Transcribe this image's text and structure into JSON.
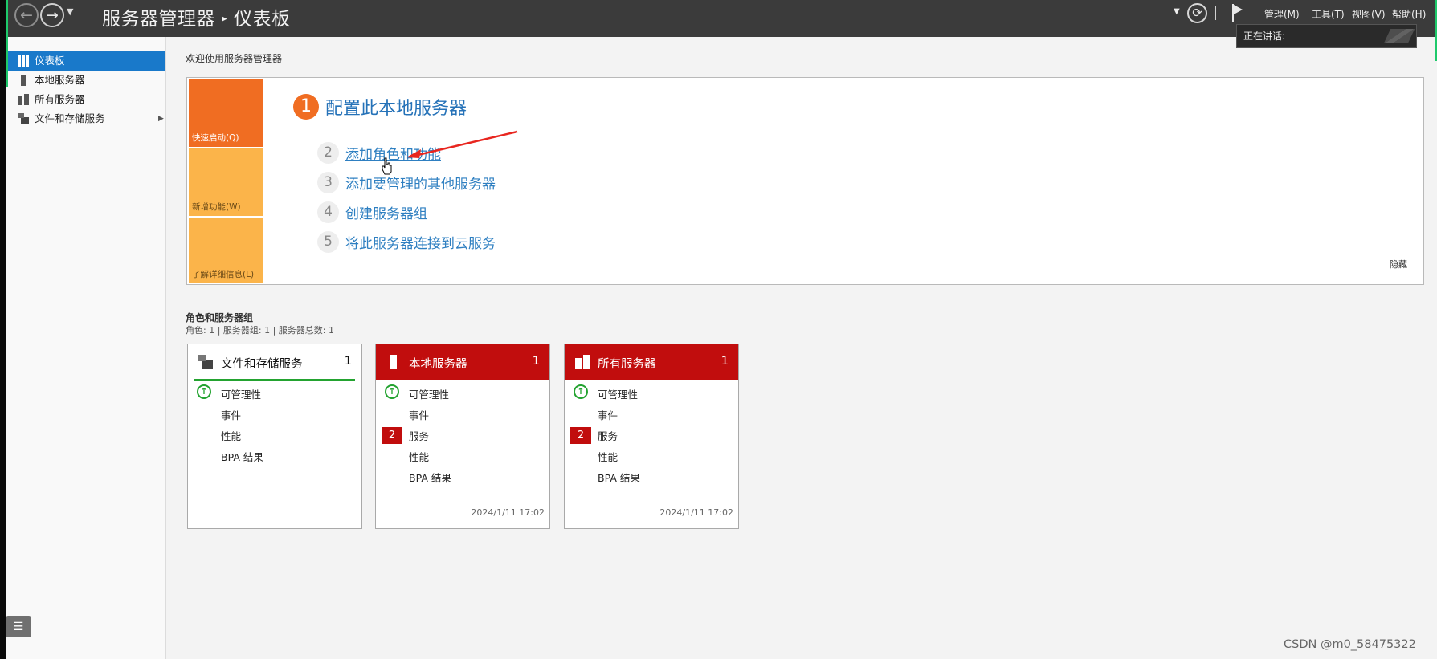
{
  "titlebar": {
    "app_title": "服务器管理器",
    "separator": "▸",
    "page_title": "仪表板",
    "menus": [
      "管理(M)",
      "工具(T)",
      "视图(V)",
      "帮助(H)"
    ],
    "tooltip": "正在讲话:"
  },
  "sidebar": {
    "items": [
      {
        "label": "仪表板",
        "icon": "dashboard-grid-icon",
        "active": true
      },
      {
        "label": "本地服务器",
        "icon": "server-icon",
        "active": false
      },
      {
        "label": "所有服务器",
        "icon": "servers-icon",
        "active": false
      },
      {
        "label": "文件和存储服务",
        "icon": "storage-icon",
        "active": false,
        "has_arrow": true
      }
    ]
  },
  "welcome": "欢迎使用服务器管理器",
  "quick_start": {
    "tiles": [
      "快速启动(Q)",
      "新增功能(W)",
      "了解详细信息(L)"
    ],
    "main_step": {
      "number": "1",
      "label": "配置此本地服务器"
    },
    "steps": [
      {
        "number": "2",
        "label": "添加角色和功能"
      },
      {
        "number": "3",
        "label": "添加要管理的其他服务器"
      },
      {
        "number": "4",
        "label": "创建服务器组"
      },
      {
        "number": "5",
        "label": "将此服务器连接到云服务"
      }
    ],
    "hide": "隐藏"
  },
  "roles": {
    "title": "角色和服务器组",
    "subtitle": "角色: 1 | 服务器组: 1 | 服务器总数: 1"
  },
  "tiles": [
    {
      "title": "文件和存储服务",
      "count": "1",
      "style": "white",
      "rows": [
        {
          "label": "可管理性",
          "status": "ok"
        },
        {
          "label": "事件"
        },
        {
          "label": "性能"
        },
        {
          "label": "BPA 结果"
        }
      ],
      "timestamp": ""
    },
    {
      "title": "本地服务器",
      "count": "1",
      "style": "red",
      "rows": [
        {
          "label": "可管理性",
          "status": "ok"
        },
        {
          "label": "事件"
        },
        {
          "label": "服务",
          "badge": "2"
        },
        {
          "label": "性能"
        },
        {
          "label": "BPA 结果"
        }
      ],
      "timestamp": "2024/1/11 17:02"
    },
    {
      "title": "所有服务器",
      "count": "1",
      "style": "red",
      "rows": [
        {
          "label": "可管理性",
          "status": "ok"
        },
        {
          "label": "事件"
        },
        {
          "label": "服务",
          "badge": "2"
        },
        {
          "label": "性能"
        },
        {
          "label": "BPA 结果"
        }
      ],
      "timestamp": "2024/1/11 17:02"
    }
  ],
  "watermark": "CSDN @m0_58475322",
  "colors": {
    "accent_blue": "#1979ca",
    "quick_orange": "#f06d22",
    "quick_yellow": "#fbb44a",
    "alert_red": "#c10d0d",
    "ok_green": "#23a330"
  }
}
